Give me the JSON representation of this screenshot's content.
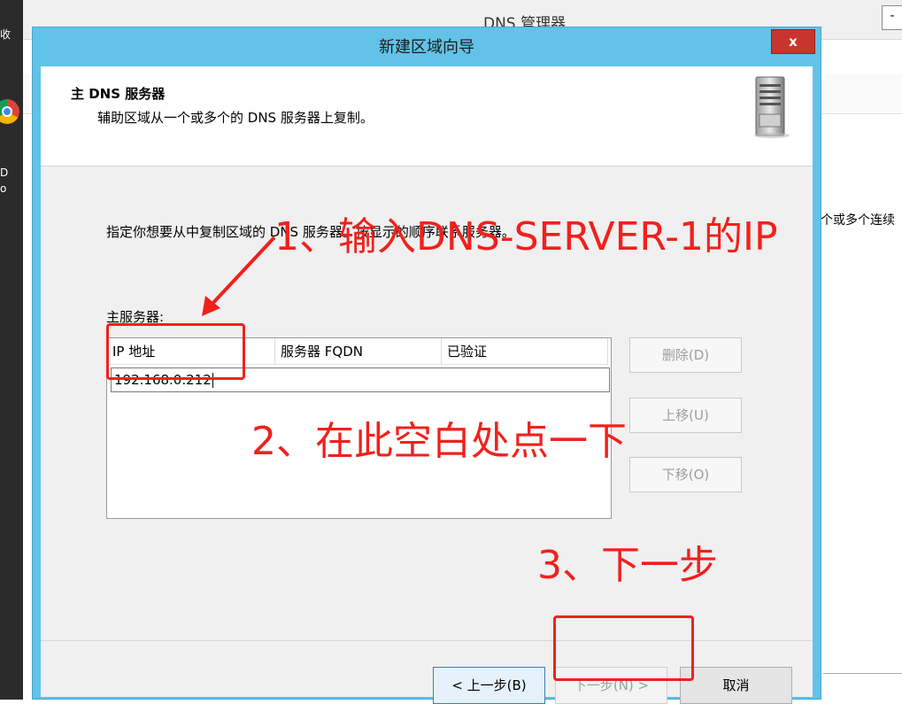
{
  "background": {
    "window_title": "DNS 管理器",
    "right_text": "个或多个连续",
    "strip_text_top": "收",
    "strip_text_mid": "D",
    "strip_text_low": "o",
    "tr_button": "-"
  },
  "dialog": {
    "title": "新建区域向导",
    "close_label": "x",
    "header_title": "主 DNS 服务器",
    "header_subtitle": "辅助区域从一个或多个的 DNS 服务器上复制。",
    "instruction": "指定你想要从中复制区域的 DNS 服务器。按显示的顺序联系服务器。",
    "primary_label": "主服务器:",
    "grid": {
      "columns": [
        "IP 地址",
        "服务器 FQDN",
        "已验证"
      ],
      "rows": [
        {
          "ip": "192.168.0.212",
          "fqdn": "",
          "verified": ""
        }
      ]
    },
    "side_buttons": {
      "delete": "删除(D)",
      "up": "上移(U)",
      "down": "下移(O)"
    },
    "nav": {
      "back": "< 上一步(B)",
      "next": "下一步(N) >",
      "cancel": "取消"
    }
  },
  "annotations": {
    "step1": "1、输入DNS-SERVER-1的IP",
    "step2": "2、在此空白处点一下",
    "step3": "3、下一步",
    "color": "#f2201c"
  }
}
